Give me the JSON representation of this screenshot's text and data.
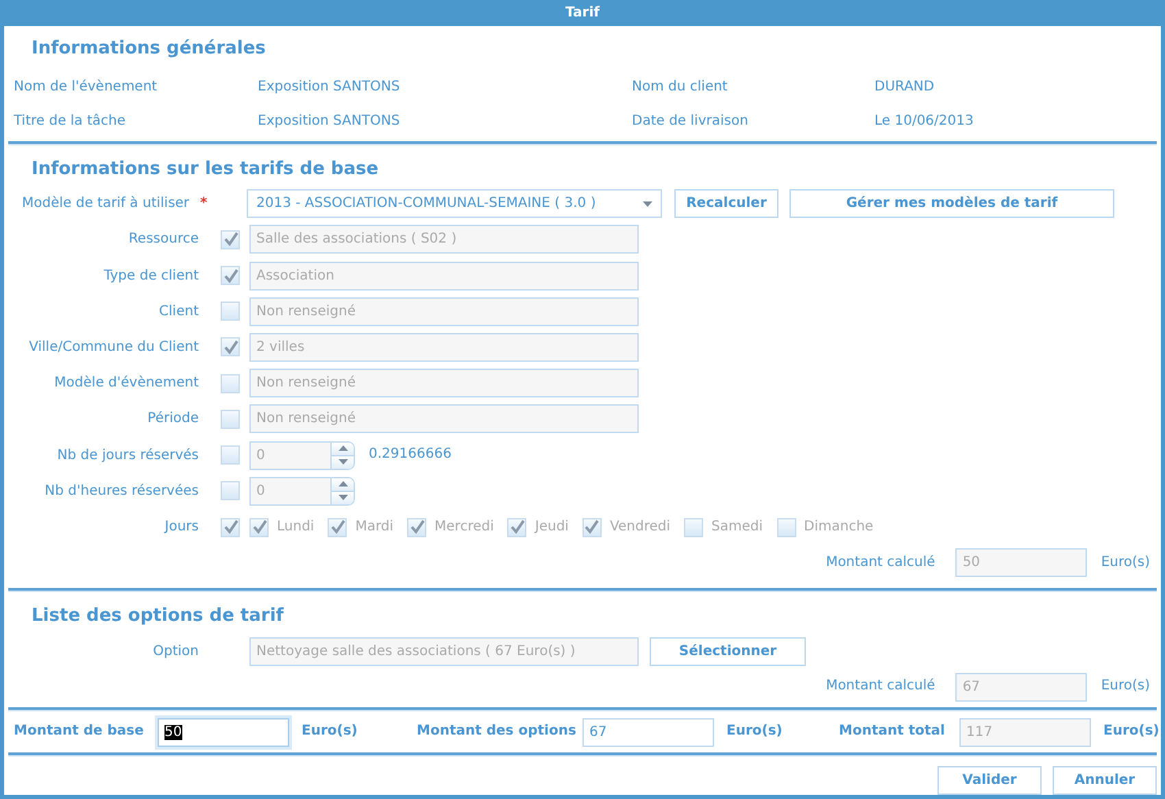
{
  "window": {
    "title": "Tarif"
  },
  "general": {
    "title": "Informations générales",
    "fields": [
      {
        "label": "Nom de l'évènement",
        "value": "Exposition SANTONS"
      },
      {
        "label": "Nom du client",
        "value": "DURAND"
      },
      {
        "label": "Titre de la tâche",
        "value": "Exposition SANTONS"
      },
      {
        "label": "Date de livraison",
        "value": "Le 10/06/2013"
      }
    ]
  },
  "base": {
    "title": "Informations sur les tarifs de base",
    "model": {
      "label": "Modèle de tarif à utiliser",
      "required_mark": "*",
      "value": "2013 - ASSOCIATION-COMMUNAL-SEMAINE ( 3.0 )",
      "buttons": [
        "Recalculer",
        "Gérer mes modèles de tarif"
      ]
    },
    "criteria": [
      {
        "kind": "text",
        "label": "Ressource",
        "checked": true,
        "disabled": true,
        "value": "Salle des associations ( S02 )"
      },
      {
        "kind": "text",
        "label": "Type de client",
        "checked": true,
        "disabled": true,
        "value": "Association"
      },
      {
        "kind": "text",
        "label": "Client",
        "checked": false,
        "disabled": true,
        "value": "Non renseigné"
      },
      {
        "kind": "text",
        "label": "Ville/Commune du Client",
        "checked": true,
        "disabled": true,
        "value": "2 villes"
      },
      {
        "kind": "text",
        "label": "Modèle d'évènement",
        "checked": false,
        "disabled": true,
        "value": "Non renseigné"
      },
      {
        "kind": "text",
        "label": "Période",
        "checked": false,
        "disabled": true,
        "value": "Non renseigné"
      },
      {
        "kind": "spin",
        "label": "Nb de jours réservés",
        "checked": false,
        "disabled": true,
        "value": "0",
        "note": "0.29166666"
      },
      {
        "kind": "spin",
        "label": "Nb d'heures réservées",
        "checked": false,
        "disabled": true,
        "value": "0"
      }
    ],
    "days": {
      "label": "Jours",
      "checked": true,
      "items": [
        {
          "label": "Lundi",
          "checked": true
        },
        {
          "label": "Mardi",
          "checked": true
        },
        {
          "label": "Mercredi",
          "checked": true
        },
        {
          "label": "Jeudi",
          "checked": true
        },
        {
          "label": "Vendredi",
          "checked": true
        },
        {
          "label": "Samedi",
          "checked": false
        },
        {
          "label": "Dimanche",
          "checked": false
        }
      ]
    },
    "computed": {
      "label": "Montant calculé",
      "value": "50",
      "unit": "Euro(s)"
    }
  },
  "options": {
    "title": "Liste des options de tarif",
    "option": {
      "label": "Option",
      "disabled": true,
      "value": "Nettoyage salle des associations ( 67 Euro(s) )",
      "button": "Sélectionner"
    },
    "computed": {
      "label": "Montant calculé",
      "value": "67",
      "unit": "Euro(s)"
    }
  },
  "totals": [
    {
      "label": "Montant de base",
      "value": "50",
      "unit": "Euro(s)",
      "disabled": false,
      "text_selected": true
    },
    {
      "label": "Montant des options",
      "value": "67",
      "unit": "Euro(s)",
      "disabled": false,
      "text_selected": false
    },
    {
      "label": "Montant total",
      "value": "117",
      "unit": "Euro(s)",
      "disabled": true,
      "text_selected": false
    }
  ],
  "buttons": [
    "Valider",
    "Annuler"
  ]
}
